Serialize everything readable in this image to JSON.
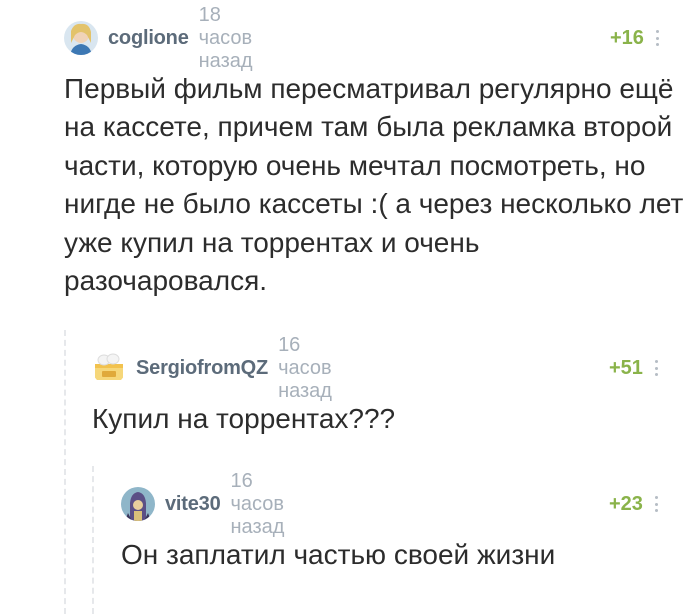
{
  "comments": [
    {
      "author": "coglione",
      "time": "18 часов назад",
      "rating": "+16",
      "text": "Первый фильм пересматривал регулярно ещё на кассете, причем там была рекламка второй части, которую очень мечтал посмотреть, но нигде не было кассеты :( а через несколько лет уже купил на торрентах и очень разочаровался."
    },
    {
      "author": "SergiofromQZ",
      "time": "16 часов назад",
      "rating": "+51",
      "text": "Купил на торрентах???"
    },
    {
      "author": "vite30",
      "time": "16 часов назад",
      "rating": "+23",
      "text": "Он заплатил частью своей жизни"
    }
  ],
  "colors": {
    "username": "#5c6b7a",
    "time": "#a7b0ba",
    "rating_positive": "#8ab34a",
    "thread_line": "#e6e8eb"
  },
  "icons": {
    "more": "more-vertical-icon"
  }
}
